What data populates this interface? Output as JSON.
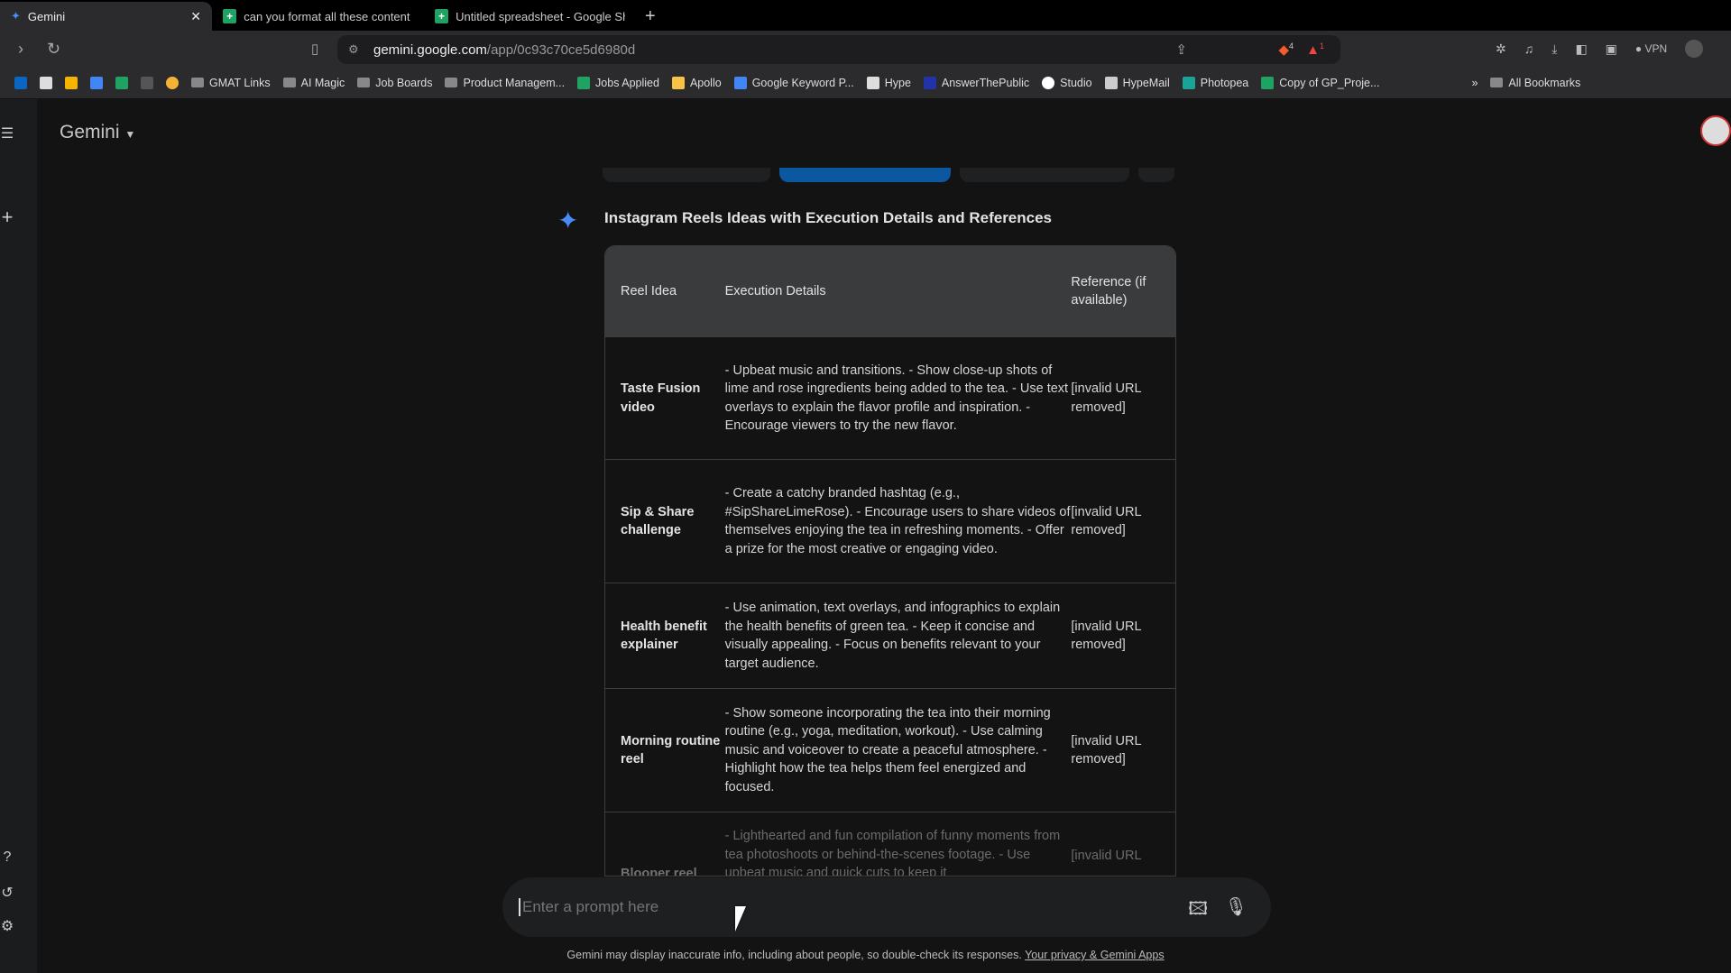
{
  "browser": {
    "tabs": [
      {
        "label": "Gemini",
        "active": true
      },
      {
        "label": "can you format all these content ic"
      },
      {
        "label": "Untitled spreadsheet - Google She"
      }
    ],
    "url_host": "gemini.google.com",
    "url_path": "/app/0c93c70ce5d6980d",
    "extension_badges": {
      "brave": "4",
      "rewards": "1"
    },
    "vpn_label": "VPN",
    "bookmarks": [
      "GMAT Links",
      "AI Magic",
      "Job Boards",
      "Product Managem...",
      "Jobs Applied",
      "Apollo",
      "Google Keyword P...",
      "Hype",
      "AnswerThePublic",
      "Studio",
      "HypeMail",
      "Photopea",
      "Copy of GP_Proje..."
    ],
    "more_bookmarks": "»",
    "all_bookmarks": "All Bookmarks"
  },
  "app": {
    "title": "Gemini"
  },
  "response": {
    "title": "Instagram Reels Ideas with Execution Details and References",
    "headers": [
      "Reel Idea",
      "Execution Details",
      "Reference (if available)"
    ],
    "rows": [
      [
        "Taste Fusion video",
        "- Upbeat music and transitions. - Show close-up shots of lime and rose ingredients being added to the tea. - Use text overlays to explain the flavor profile and inspiration. - Encourage viewers to try the new flavor.",
        "[invalid URL removed]"
      ],
      [
        "Sip & Share challenge",
        "- Create a catchy branded hashtag (e.g., #SipShareLimeRose). - Encourage users to share videos of themselves enjoying the tea in refreshing moments. - Offer a prize for the most creative or engaging video.",
        "[invalid URL removed]"
      ],
      [
        "Health benefit explainer",
        "- Use animation, text overlays, and infographics to explain the health benefits of green tea. - Keep it concise and visually appealing. - Focus on benefits relevant to your target audience.",
        "[invalid URL removed]"
      ],
      [
        "Morning routine reel",
        "- Show someone incorporating the tea into their morning routine (e.g., yoga, meditation, workout). - Use calming music and voiceover to create a peaceful atmosphere. - Highlight how the tea helps them feel energized and focused.",
        "[invalid URL removed]"
      ],
      [
        "Blooper reel",
        "- Lighthearted and fun compilation of funny moments from tea photoshoots or behind-the-scenes footage. - Use upbeat music and quick cuts to keep it",
        "[invalid URL"
      ]
    ]
  },
  "prompt": {
    "placeholder": "Enter a prompt here"
  },
  "footer": {
    "disclaimer": "Gemini may display inaccurate info, including about people, so double-check its responses.",
    "link": "Your privacy & Gemini Apps"
  },
  "colors": {
    "accent": "#4a8cf7",
    "background": "#131314"
  }
}
